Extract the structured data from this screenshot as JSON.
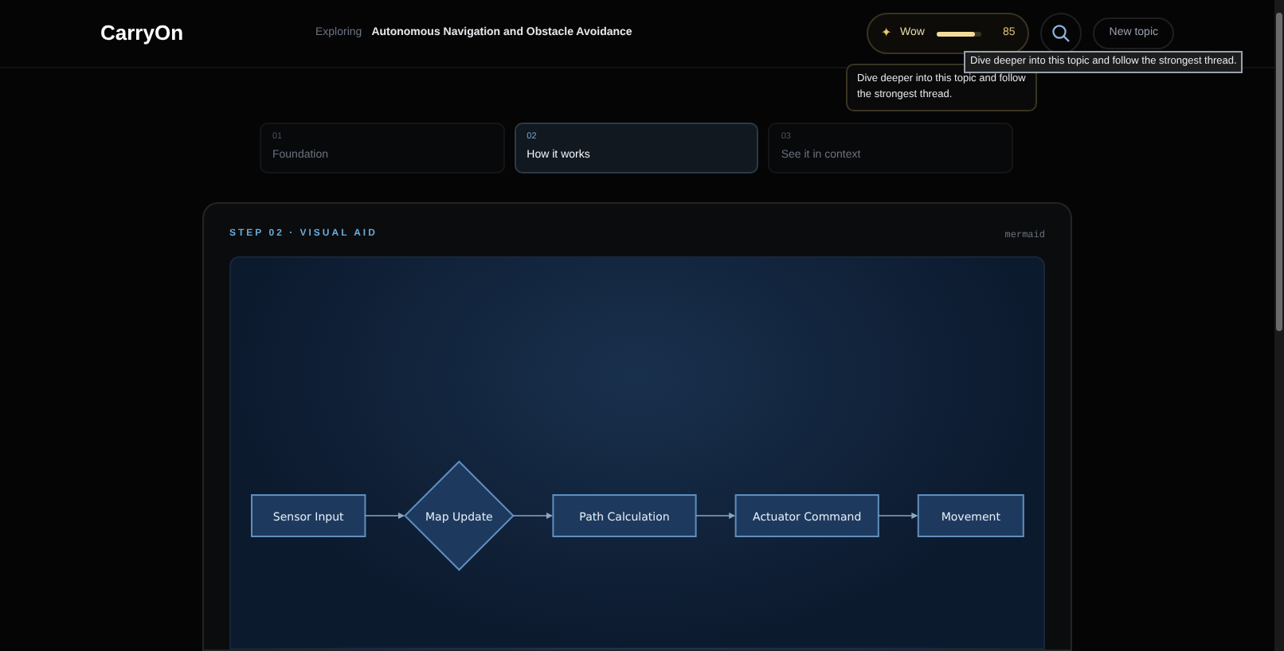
{
  "header": {
    "logo": "CarryOn",
    "exploring_label": "Exploring",
    "topic": "Autonomous Navigation and Obstacle Avoidance",
    "wow": {
      "icon": "✦",
      "label": "Wow",
      "level": 0.85,
      "reading": "85"
    },
    "new_topic_button": "New topic"
  },
  "tooltip": "Dive deeper into this topic and follow the strongest thread.",
  "popover": "Dive deeper into this topic and follow the strongest thread.",
  "steps": [
    {
      "number": "01",
      "label": "Foundation",
      "selected": false
    },
    {
      "number": "02",
      "label": "How it works",
      "selected": true
    },
    {
      "number": "03",
      "label": "See it in context",
      "selected": false
    }
  ],
  "panel": {
    "heading": "STEP 02 · VISUAL AID",
    "format": "mermaid",
    "diagram": {
      "nodes": [
        {
          "kind": "rect",
          "label": "Sensor Input"
        },
        {
          "kind": "diamond",
          "label": "Map Update"
        },
        {
          "kind": "rect",
          "label": "Path Calculation"
        },
        {
          "kind": "rect",
          "label": "Actuator Command"
        },
        {
          "kind": "rect",
          "label": "Movement"
        }
      ]
    }
  }
}
